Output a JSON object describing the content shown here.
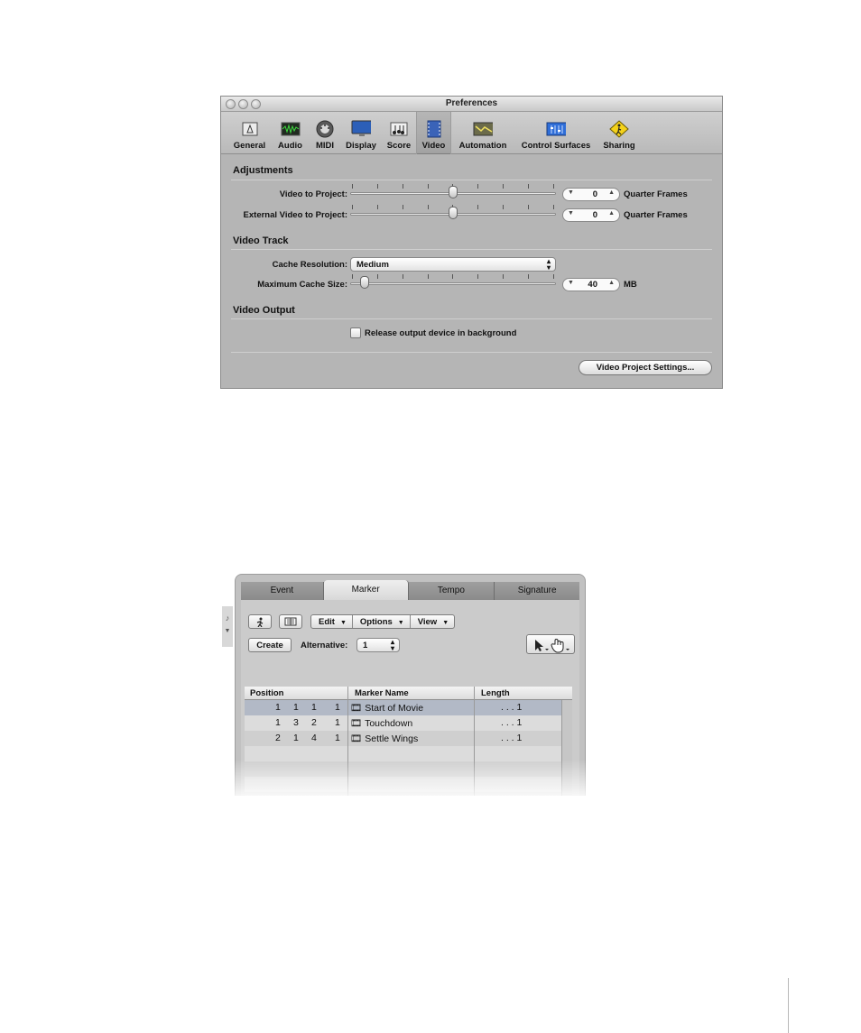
{
  "preferences": {
    "title": "Preferences",
    "toolbar": [
      {
        "label": "General",
        "icon": "general-icon"
      },
      {
        "label": "Audio",
        "icon": "audio-icon"
      },
      {
        "label": "MIDI",
        "icon": "midi-icon"
      },
      {
        "label": "Display",
        "icon": "display-icon"
      },
      {
        "label": "Score",
        "icon": "score-icon"
      },
      {
        "label": "Video",
        "icon": "video-icon",
        "active": true
      },
      {
        "label": "Automation",
        "icon": "automation-icon"
      },
      {
        "label": "Control Surfaces",
        "icon": "control-surfaces-icon"
      },
      {
        "label": "Sharing",
        "icon": "sharing-icon"
      }
    ],
    "adjustments": {
      "title": "Adjustments",
      "video_to_project": {
        "label": "Video to Project:",
        "value": "0",
        "unit": "Quarter Frames",
        "slider_level": 0.5
      },
      "external_video_to_project": {
        "label": "External Video to Project:",
        "value": "0",
        "unit": "Quarter Frames",
        "slider_level": 0.5
      }
    },
    "video_track": {
      "title": "Video Track",
      "cache_resolution": {
        "label": "Cache Resolution:",
        "value": "Medium"
      },
      "max_cache_size": {
        "label": "Maximum Cache Size:",
        "value": "40",
        "unit": "MB",
        "slider_level": 0.05
      }
    },
    "video_output": {
      "title": "Video Output",
      "release_output": {
        "label": "Release output device in background",
        "checked": false
      }
    },
    "video_project_settings_button": "Video Project Settings..."
  },
  "lists": {
    "tabs": [
      {
        "label": "Event"
      },
      {
        "label": "Marker",
        "active": true
      },
      {
        "label": "Tempo"
      },
      {
        "label": "Signature"
      }
    ],
    "menus": {
      "edit": "Edit",
      "options": "Options",
      "view": "View"
    },
    "create_button": "Create",
    "alternative": {
      "label": "Alternative:",
      "value": "1"
    },
    "columns": {
      "position": "Position",
      "marker_name": "Marker Name",
      "length": "Length"
    },
    "rows": [
      {
        "position": [
          "1",
          "1",
          "1",
          "1"
        ],
        "name": "Start of Movie",
        "length": ". . .  1",
        "selected": true
      },
      {
        "position": [
          "1",
          "3",
          "2",
          "1"
        ],
        "name": "Touchdown",
        "length": ". . .  1"
      },
      {
        "position": [
          "2",
          "1",
          "4",
          "1"
        ],
        "name": "Settle Wings",
        "length": ". . .  1"
      }
    ]
  }
}
